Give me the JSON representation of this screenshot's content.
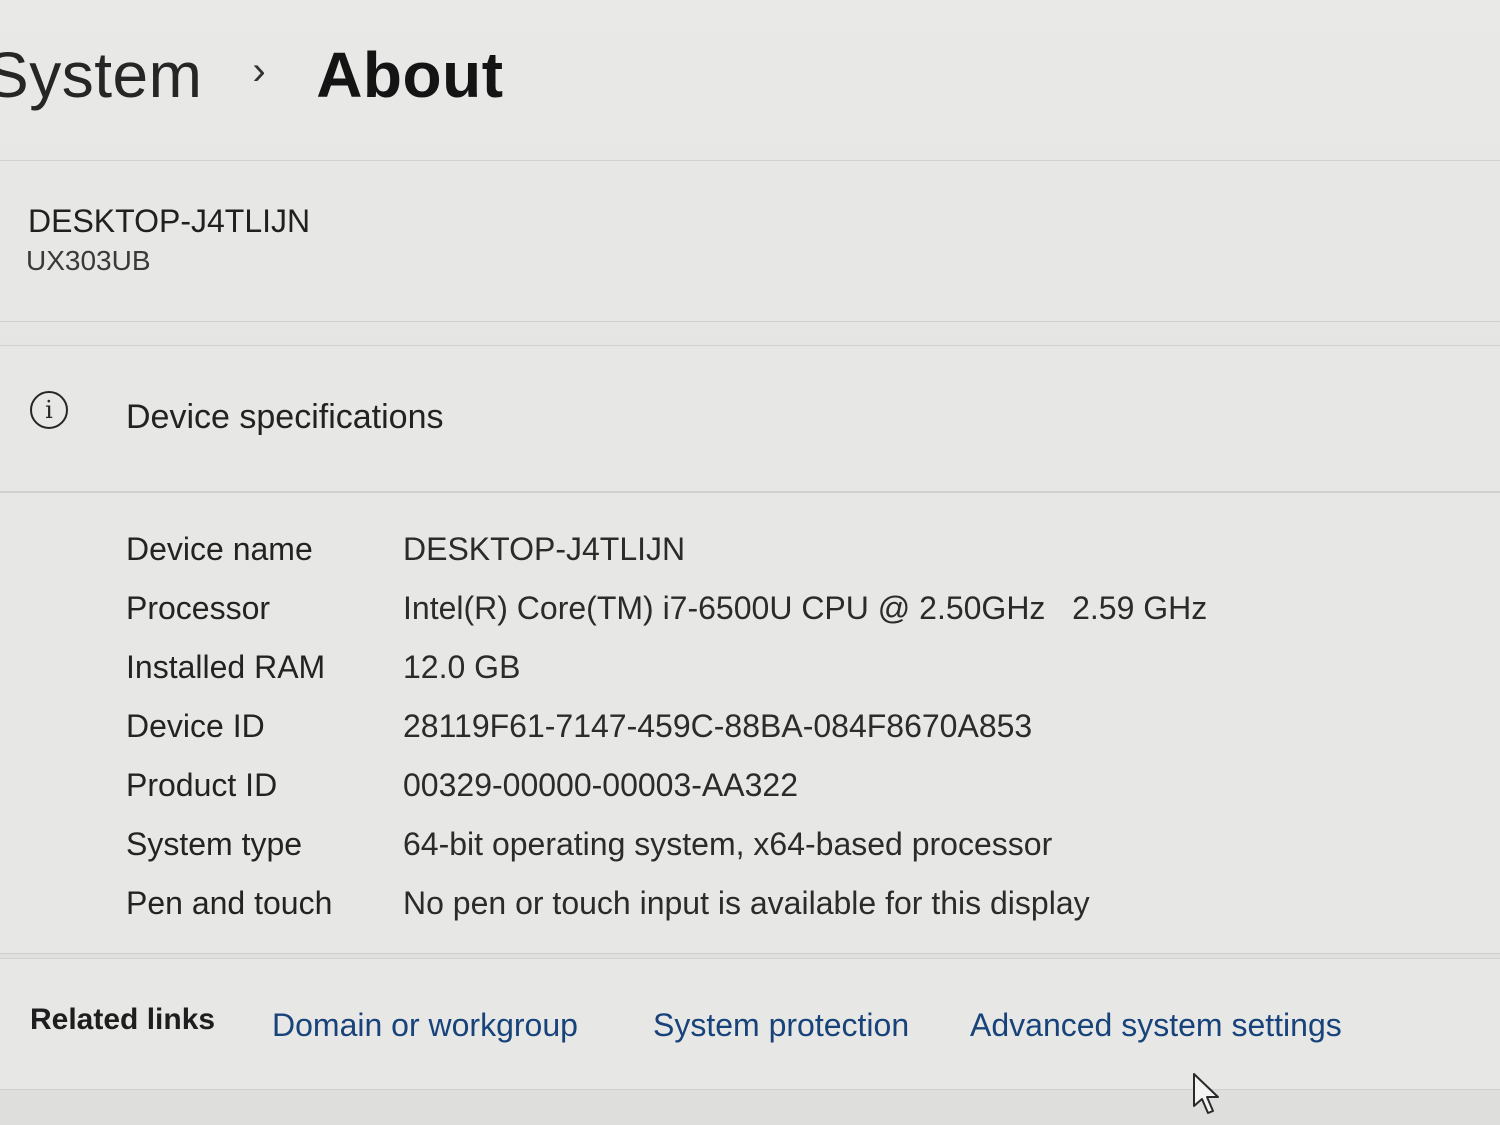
{
  "breadcrumb": {
    "parent": "System",
    "separator": "›",
    "current": "About"
  },
  "device": {
    "name": "DESKTOP-J4TLIJN",
    "model": "UX303UB"
  },
  "specifications": {
    "icon": "info-icon",
    "title": "Device specifications",
    "rows": [
      {
        "label": "Device name",
        "value": "DESKTOP-J4TLIJN"
      },
      {
        "label": "Processor",
        "value": "Intel(R) Core(TM) i7-6500U CPU @ 2.50GHz   2.59 GHz"
      },
      {
        "label": "Installed RAM",
        "value": "12.0 GB"
      },
      {
        "label": "Device ID",
        "value": "28119F61-7147-459C-88BA-084F8670A853"
      },
      {
        "label": "Product ID",
        "value": "00329-00000-00003-AA322"
      },
      {
        "label": "System type",
        "value": "64-bit operating system, x64-based processor"
      },
      {
        "label": "Pen and touch",
        "value": "No pen or touch input is available for this display"
      }
    ]
  },
  "related_links": {
    "label": "Related links",
    "links": [
      "Domain or workgroup",
      "System protection",
      "Advanced system settings"
    ]
  },
  "colors": {
    "link": "#17437a",
    "background": "#e6e6e4"
  }
}
